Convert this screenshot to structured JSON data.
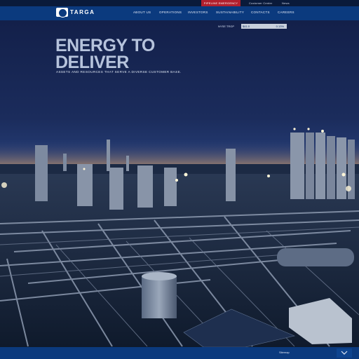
{
  "utility": {
    "emergency_label": "PIPELINE EMERGENCY",
    "customer_center_label": "Customer Center",
    "news_label": "News"
  },
  "header": {
    "logo_text": "TARGA",
    "nav": [
      "ABOUT US",
      "OPERATIONS",
      "INVESTORS",
      "SUSTAINABILITY",
      "CONTACTS",
      "CAREERS"
    ]
  },
  "stock": {
    "label": "NYSE TRGP",
    "price": "$41.0",
    "change": "0.13%"
  },
  "hero": {
    "title_line1": "ENERGY TO",
    "title_line2": "DELIVER",
    "subtitle": "ASSETS AND RESOURCES THAT SERVE A DIVERSE CUSTOMER BASE."
  },
  "footer": {
    "sitemap_label": "Sitemap"
  },
  "colors": {
    "header_blue": "#0b3a7e",
    "emergency_red": "#b21f2d",
    "night_sky": "#1b2c5c",
    "title_color": "#b6c3dc"
  }
}
